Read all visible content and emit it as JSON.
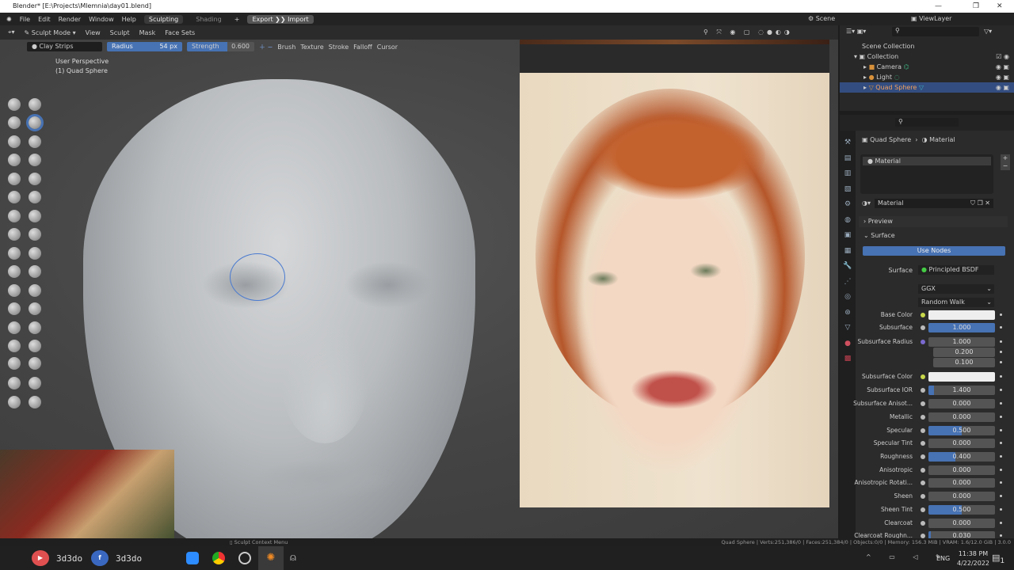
{
  "window": {
    "title": "Blender* [E:\\Projects\\Mlemnia\\day01.blend]",
    "min": "—",
    "max": "❐",
    "close": "✕"
  },
  "menu": [
    "File",
    "Edit",
    "Render",
    "Window",
    "Help"
  ],
  "workspaces": [
    "Sculpting",
    "Shading",
    "+"
  ],
  "export": "Export",
  "import": "Import",
  "scene": "Scene",
  "viewlayer": "ViewLayer",
  "header": {
    "mode": "Sculpt Mode",
    "items": [
      "View",
      "Sculpt",
      "Mask",
      "Face Sets"
    ]
  },
  "tool": {
    "brush": "Clay Strips",
    "radius_label": "Radius",
    "radius": "54 px",
    "strength_label": "Strength",
    "strength": "0.600",
    "menus": [
      "Brush",
      "Texture",
      "Stroke",
      "Falloff",
      "Cursor"
    ]
  },
  "viewport": {
    "perspective": "User Perspective",
    "object": "(1) Quad Sphere"
  },
  "outliner": {
    "items": [
      "Scene Collection",
      "Collection",
      "Camera",
      "Light",
      "Quad Sphere"
    ]
  },
  "properties": {
    "breadcrumb_object": "Quad Sphere",
    "breadcrumb_material": "Material",
    "slot": "Material",
    "material_name": "Material",
    "preview": "Preview",
    "surface_panel": "Surface",
    "use_nodes": "Use Nodes",
    "surface_label": "Surface",
    "surface_shader": "Principled BSDF",
    "distribution": "GGX",
    "subsurface_method": "Random Walk",
    "rows": [
      {
        "label": "Base Color",
        "value": "",
        "color": "#eeeeee",
        "dot": "#c8d84a"
      },
      {
        "label": "Subsurface",
        "value": "1.000",
        "fill": 1.0
      },
      {
        "label": "Subsurface Radius",
        "value": "1.000",
        "dot": "#7a6ad0"
      },
      {
        "label": "",
        "value": "0.200"
      },
      {
        "label": "",
        "value": "0.100"
      },
      {
        "label": "Subsurface Color",
        "value": "",
        "color": "#eeeeee",
        "dot": "#c8d84a"
      },
      {
        "label": "Subsurface IOR",
        "value": "1.400",
        "fill": 0.08
      },
      {
        "label": "Subsurface Anisot...",
        "value": "0.000"
      },
      {
        "label": "Metallic",
        "value": "0.000"
      },
      {
        "label": "Specular",
        "value": "0.500",
        "fill": 0.5
      },
      {
        "label": "Specular Tint",
        "value": "0.000"
      },
      {
        "label": "Roughness",
        "value": "0.400",
        "fill": 0.4
      },
      {
        "label": "Anisotropic",
        "value": "0.000"
      },
      {
        "label": "Anisotropic Rotati...",
        "value": "0.000"
      },
      {
        "label": "Sheen",
        "value": "0.000"
      },
      {
        "label": "Sheen Tint",
        "value": "0.500",
        "fill": 0.5
      },
      {
        "label": "Clearcoat",
        "value": "0.000"
      },
      {
        "label": "Clearcoat Roughn...",
        "value": "0.030",
        "fill": 0.03
      }
    ]
  },
  "status": {
    "context": "Sculpt Context Menu",
    "stats": "Quad Sphere | Verts:251,386/0 | Faces:251,384/0 | Objects:0/0 | Memory: 156.3 MiB | VRAM: 1.6/12.0 GiB | 3.0.0"
  },
  "taskbar": {
    "youtube": "3d3do",
    "facebook": "3d3do",
    "lang": "ENG",
    "time": "11:38 PM",
    "date": "4/22/2022",
    "notifications": "1"
  }
}
